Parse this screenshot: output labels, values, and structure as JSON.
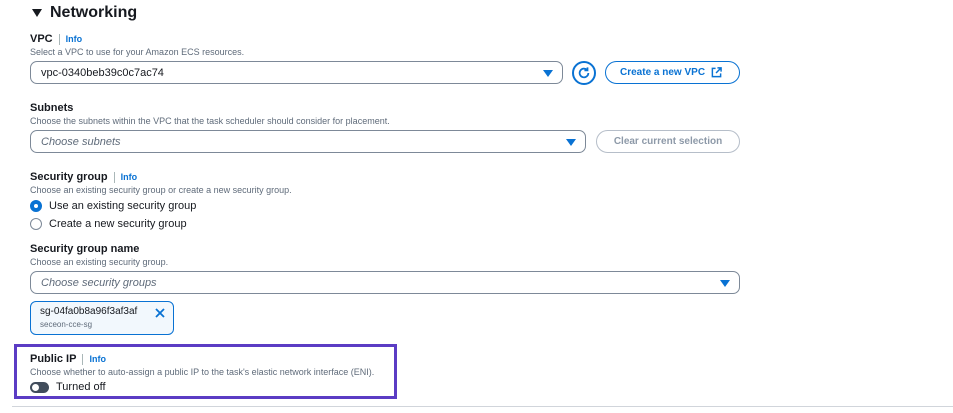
{
  "section": {
    "title": "Networking"
  },
  "vpc": {
    "label": "VPC",
    "info": "Info",
    "description": "Select a VPC to use for your Amazon ECS resources.",
    "selected": "vpc-0340beb39c0c7ac74",
    "create_label": "Create a new VPC"
  },
  "subnets": {
    "label": "Subnets",
    "description": "Choose the subnets within the VPC that the task scheduler should consider for placement.",
    "placeholder": "Choose subnets",
    "clear_label": "Clear current selection"
  },
  "security_group": {
    "label": "Security group",
    "info": "Info",
    "description": "Choose an existing security group or create a new security group.",
    "options": [
      {
        "label": "Use an existing security group",
        "checked": true
      },
      {
        "label": "Create a new security group",
        "checked": false
      }
    ]
  },
  "security_group_name": {
    "label": "Security group name",
    "description": "Choose an existing security group.",
    "placeholder": "Choose security groups",
    "token": {
      "id": "sg-04fa0b8a96f3af3af",
      "name": "seceon-cce-sg"
    }
  },
  "public_ip": {
    "label": "Public IP",
    "info": "Info",
    "description": "Choose whether to auto-assign a public IP to the task's elastic network interface (ENI).",
    "state": "Turned off"
  },
  "colors": {
    "accent": "#0972d3",
    "highlight": "#5b3cc4"
  }
}
